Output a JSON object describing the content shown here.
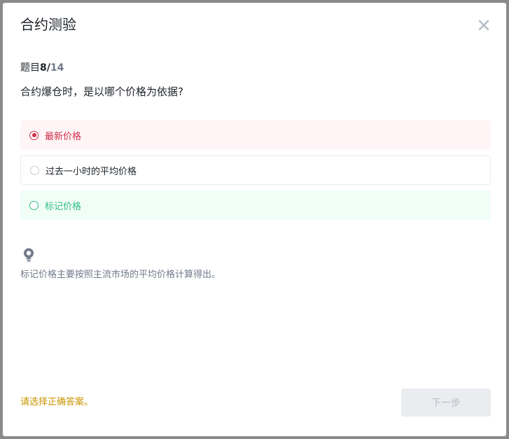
{
  "dialog": {
    "title": "合约测验",
    "close_icon": "close-icon"
  },
  "progress": {
    "label": "题目",
    "current": "8/",
    "total": "14"
  },
  "question": "合约爆仓时，是以哪个价格为依据?",
  "options": [
    {
      "label": "最新价格",
      "state": "wrong-selected"
    },
    {
      "label": "过去一小时的平均价格",
      "state": "unselected"
    },
    {
      "label": "标记价格",
      "state": "correct"
    }
  ],
  "hint": {
    "icon": "lightbulb-icon",
    "text": "标记价格主要按照主流市场的平均价格计算得出。"
  },
  "footer": {
    "message": "请选择正确答案。",
    "next_label": "下一步"
  },
  "colors": {
    "wrong": "#cf304a",
    "correct": "#2ebd85",
    "warning": "#c99400",
    "disabled_bg": "#eaecef"
  }
}
